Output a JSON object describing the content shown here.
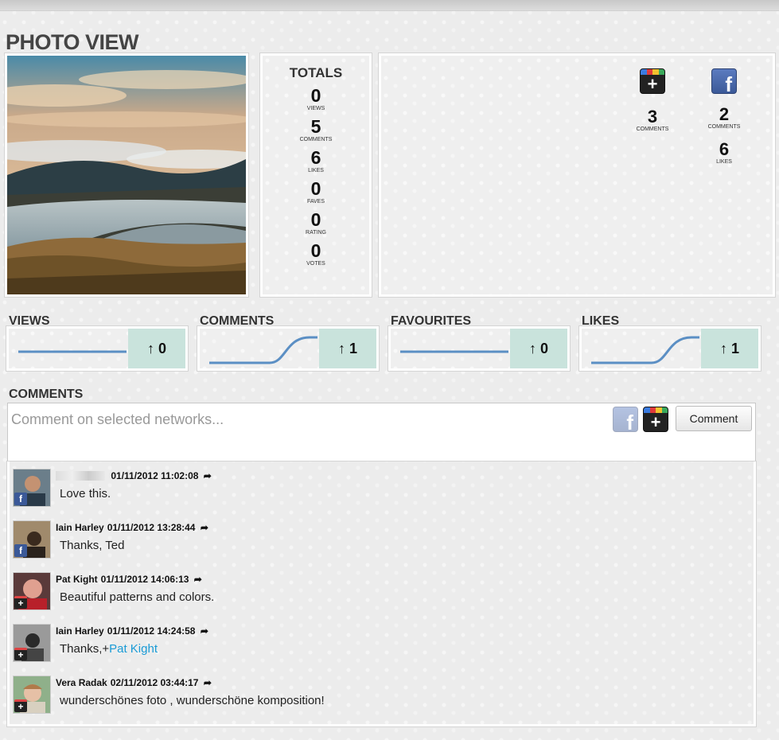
{
  "page": {
    "title": "PHOTO VIEW"
  },
  "totals": {
    "title": "TOTALS",
    "stats": [
      {
        "value": "0",
        "label": "VIEWS"
      },
      {
        "value": "5",
        "label": "COMMENTS"
      },
      {
        "value": "6",
        "label": "LIKES"
      },
      {
        "value": "0",
        "label": "FAVES"
      },
      {
        "value": "0",
        "label": "RATING"
      },
      {
        "value": "0",
        "label": "VOTES"
      }
    ]
  },
  "networks": {
    "google": {
      "icon": "google-plus-icon",
      "comments": "3",
      "comments_label": "COMMENTS"
    },
    "facebook": {
      "icon": "facebook-icon",
      "comments": "2",
      "comments_label": "COMMENTS",
      "likes": "6",
      "likes_label": "LIKES"
    }
  },
  "metrics": [
    {
      "label": "VIEWS",
      "delta": "0",
      "arrow": "↑",
      "trend": "flat"
    },
    {
      "label": "COMMENTS",
      "delta": "1",
      "arrow": "↑",
      "trend": "rise"
    },
    {
      "label": "FAVOURITES",
      "delta": "0",
      "arrow": "↑",
      "trend": "flat"
    },
    {
      "label": "LIKES",
      "delta": "1",
      "arrow": "↑",
      "trend": "rise"
    }
  ],
  "comments_section": {
    "label": "COMMENTS",
    "placeholder": "Comment on selected networks...",
    "button": "Comment",
    "items": [
      {
        "name": "",
        "date": "01/11/2012 11:02:08",
        "text": "Love this.",
        "mention": "",
        "network": "facebook"
      },
      {
        "name": "Iain Harley",
        "date": "01/11/2012 13:28:44",
        "text": "Thanks, Ted",
        "mention": "",
        "network": "facebook"
      },
      {
        "name": "Pat Kight",
        "date": "01/11/2012 14:06:13",
        "text": "Beautiful patterns and colors.",
        "mention": "",
        "network": "google"
      },
      {
        "name": "Iain Harley",
        "date": "01/11/2012 14:24:58",
        "text": "Thanks,+",
        "mention": "Pat Kight",
        "network": "google"
      },
      {
        "name": "Vera Radak",
        "date": "02/11/2012 03:44:17",
        "text": "wunderschönes foto , wunderschöne komposition!",
        "mention": "",
        "network": "google"
      }
    ]
  },
  "colors": {
    "accent": "#c9e3dc",
    "line": "#5b8fc4",
    "facebook": "#3b5998",
    "mention": "#1a9bd6"
  }
}
